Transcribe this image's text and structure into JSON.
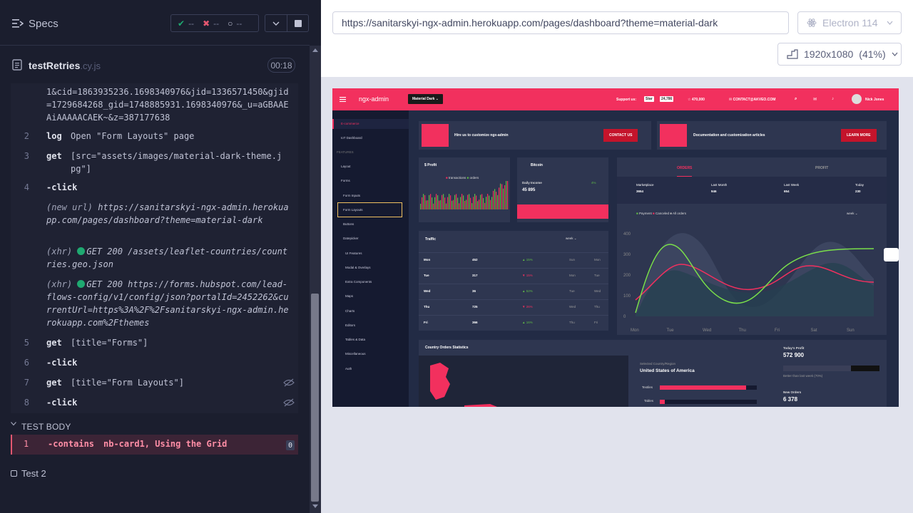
{
  "runner": {
    "title": "Specs",
    "stats": {
      "passed": "--",
      "failed": "--",
      "pending": "--"
    },
    "spec": {
      "name": "testRetries",
      "ext": ".cy.js",
      "duration": "00:18"
    },
    "commands": [
      {
        "kind": "wrap",
        "text": "1&cid=1863935236.1698340976&jid=1336571450&gjid=1729684268_gid=1748885931.1698340976&_u=aGBAAEAiAAAAACAEK~&z=387177638"
      },
      {
        "kind": "cmd",
        "num": "2",
        "name": "log",
        "msg": "Open \"Form Layouts\" page"
      },
      {
        "kind": "cmd",
        "num": "3",
        "name": "get",
        "msg": "[src=\"assets/images/material-dark-theme.jpg\"]"
      },
      {
        "kind": "cmd",
        "num": "4",
        "name": "-click",
        "msg": ""
      },
      {
        "kind": "event",
        "label": "(new url)",
        "text": "https://sanitarskyi-ngx-admin.herokuapp.com/pages/dashboard?theme=material-dark"
      },
      {
        "kind": "xhr",
        "label": "(xhr)",
        "text": "GET 200 /assets/leaflet-countries/countries.geo.json"
      },
      {
        "kind": "xhr",
        "label": "(xhr)",
        "text": "GET 200 https://forms.hubspot.com/lead-flows-config/v1/config/json?portalId=2452262&currentUrl=https%3A%2F%2Fsanitarskyi-ngx-admin.herokuapp.com%2Fthemes"
      },
      {
        "kind": "cmd",
        "num": "5",
        "name": "get",
        "msg": "[title=\"Forms\"]"
      },
      {
        "kind": "cmd",
        "num": "6",
        "name": "-click",
        "msg": ""
      },
      {
        "kind": "cmd",
        "num": "7",
        "name": "get",
        "msg": "[title=\"Form Layouts\"]"
      },
      {
        "kind": "cmd",
        "num": "8",
        "name": "-click",
        "msg": ""
      }
    ],
    "test_body_label": "TEST BODY",
    "failed_cmd": {
      "num": "1",
      "name": "-contains",
      "msg": "nb-card1, Using the Grid",
      "badge": "0"
    },
    "test2_label": "Test 2",
    "colors": {
      "bg": "#1b1e2e",
      "pass": "#1fa971",
      "fail": "#e45770"
    }
  },
  "aut": {
    "url": "https://sanitarskyi-ngx-admin.herokuapp.com/pages/dashboard?theme=material-dark",
    "browser": "Electron 114",
    "viewport": "1920x1080",
    "scale": "(41%)"
  },
  "app": {
    "brand": "ngx-admin",
    "theme_select": "Material Dark",
    "support_label": "Support us:",
    "star_label": "Star",
    "star_count": "24,786",
    "stars_total": "470,000",
    "contact_email": "CONTACT@AKVEO.COM",
    "user_name": "Nick Jones",
    "menu": [
      "E-commerce",
      "IoT Dashboard",
      "FEATURES",
      "Layout",
      "Forms",
      "Form Inputs",
      "Form Layouts",
      "Buttons",
      "Datepicker",
      "UI Features",
      "Modal & Overlays",
      "Extra Components",
      "Maps",
      "Charts",
      "Editors",
      "Tables & Data",
      "Miscellaneous",
      "Auth"
    ],
    "banner1": {
      "text": "Hire us to customize ngx-admin",
      "button": "CONTACT US"
    },
    "banner2": {
      "text": "Documentation and customization articles",
      "button": "LEARN MORE"
    },
    "profit_card": {
      "title": "$ Profit",
      "legend": [
        "transactions",
        "orders"
      ]
    },
    "bitcoin_card": {
      "title": "Bitcoin",
      "label": "Daily Income",
      "value": "45 895",
      "delta": "4%"
    },
    "orders_tabs": [
      "ORDERS",
      "PROFIT"
    ],
    "orders_stats": [
      {
        "label": "Marketplace",
        "value": "3654"
      },
      {
        "label": "Last Month",
        "value": "946"
      },
      {
        "label": "Last Week",
        "value": "654"
      },
      {
        "label": "Today",
        "value": "230"
      }
    ],
    "orders_legend": [
      "Payment",
      "Canceled",
      "All orders"
    ],
    "period": "week",
    "y_ticks": [
      "400",
      "300",
      "200",
      "100",
      "0"
    ],
    "x_ticks": [
      "Mon",
      "Tue",
      "Wed",
      "Thu",
      "Fri",
      "Sat",
      "Sun"
    ],
    "traffic": {
      "title": "Traffic",
      "period": "week",
      "rows": [
        {
          "day": "Mon",
          "value": "452",
          "delta": "15%",
          "up": true,
          "cmp": "Sun"
        },
        {
          "day": "Tue",
          "value": "317",
          "delta": "15%",
          "up": false,
          "cmp": "Mon"
        },
        {
          "day": "Wed",
          "value": "36",
          "delta": "52%",
          "up": true,
          "cmp": "Tue"
        },
        {
          "day": "Thu",
          "value": "725",
          "delta": "26%",
          "up": false,
          "cmp": "Wed"
        },
        {
          "day": "Fri",
          "value": "366",
          "delta": "16%",
          "up": true,
          "cmp": "Thu"
        }
      ],
      "cmp_label": [
        "Mon",
        "Tue",
        "Wed",
        "Thu",
        "Fri"
      ]
    },
    "country": {
      "title": "Country Orders Statistics",
      "selected_label": "Selected Country/Region",
      "country": "United States of America",
      "bars": [
        "Textiles",
        "Tables"
      ]
    },
    "today_profit": {
      "label": "Today's Profit",
      "value": "572 900",
      "note": "Better than last week (70%)"
    },
    "new_orders": {
      "label": "New Orders",
      "value": "6 378"
    }
  }
}
